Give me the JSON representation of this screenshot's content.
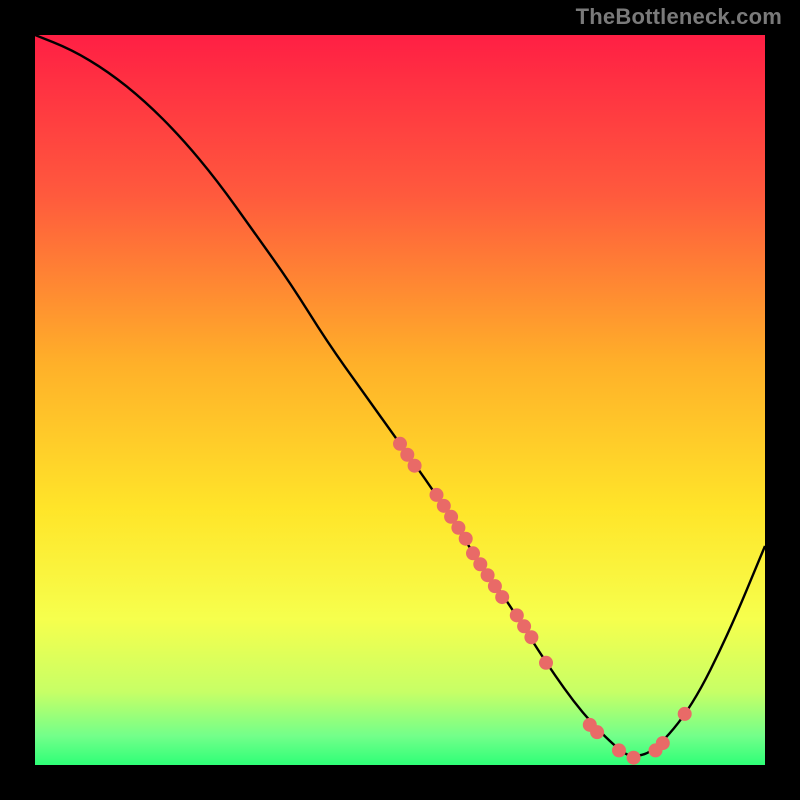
{
  "attribution": "TheBottleneck.com",
  "chart_data": {
    "type": "line",
    "title": "",
    "xlabel": "",
    "ylabel": "",
    "xlim": [
      0,
      100
    ],
    "ylim": [
      0,
      100
    ],
    "series": [
      {
        "name": "curve",
        "x": [
          0,
          5,
          10,
          15,
          20,
          25,
          30,
          35,
          40,
          45,
          50,
          55,
          60,
          65,
          70,
          75,
          80,
          82,
          85,
          90,
          95,
          100
        ],
        "y": [
          100,
          98,
          95,
          91,
          86,
          80,
          73,
          66,
          58,
          51,
          44,
          37,
          29,
          22,
          14,
          7,
          2,
          1,
          2,
          8,
          18,
          30
        ]
      }
    ],
    "highlight_points": [
      {
        "x": 50,
        "y": 44
      },
      {
        "x": 51,
        "y": 42.5
      },
      {
        "x": 52,
        "y": 41
      },
      {
        "x": 55,
        "y": 37
      },
      {
        "x": 56,
        "y": 35.5
      },
      {
        "x": 57,
        "y": 34
      },
      {
        "x": 58,
        "y": 32.5
      },
      {
        "x": 59,
        "y": 31
      },
      {
        "x": 60,
        "y": 29
      },
      {
        "x": 61,
        "y": 27.5
      },
      {
        "x": 62,
        "y": 26
      },
      {
        "x": 63,
        "y": 24.5
      },
      {
        "x": 64,
        "y": 23
      },
      {
        "x": 66,
        "y": 20.5
      },
      {
        "x": 67,
        "y": 19
      },
      {
        "x": 68,
        "y": 17.5
      },
      {
        "x": 70,
        "y": 14
      },
      {
        "x": 76,
        "y": 5.5
      },
      {
        "x": 77,
        "y": 4.5
      },
      {
        "x": 80,
        "y": 2
      },
      {
        "x": 82,
        "y": 1
      },
      {
        "x": 85,
        "y": 2
      },
      {
        "x": 86,
        "y": 3
      },
      {
        "x": 89,
        "y": 7
      }
    ],
    "gradient_stops": [
      {
        "offset": 0.0,
        "color": "#ff1f44"
      },
      {
        "offset": 0.22,
        "color": "#ff5a3d"
      },
      {
        "offset": 0.45,
        "color": "#ffb029"
      },
      {
        "offset": 0.65,
        "color": "#ffe529"
      },
      {
        "offset": 0.8,
        "color": "#f6ff4d"
      },
      {
        "offset": 0.9,
        "color": "#c7ff66"
      },
      {
        "offset": 0.96,
        "color": "#73ff8a"
      },
      {
        "offset": 1.0,
        "color": "#2eff77"
      }
    ],
    "curve_color": "#000000",
    "point_color": "#e96a67",
    "point_radius": 7
  }
}
